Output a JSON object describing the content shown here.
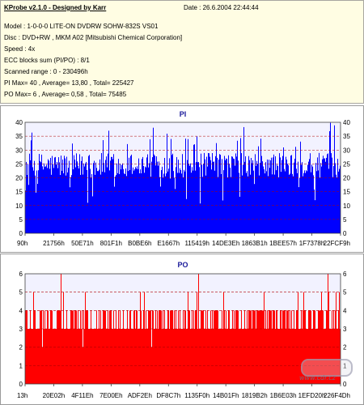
{
  "header": {
    "title": "KProbe v2.1.0 - Designed by Karr",
    "date": "Date : 26.6.2004 22:44:44",
    "lines": [
      "Model : 1-0-0-0 LITE-ON DVDRW SOHW-832S  VS01",
      "Disc : DVD+RW , MKM A02 [Mitsubishi Chemical Corporation]",
      "Speed : 4x",
      "ECC blocks sum (PI/PO) : 8/1",
      "Scanned range : 0 - 230496h",
      "PI Max= 40 , Average= 13,80 , Total= 225427",
      "PO Max= 6 , Average= 0,58 , Total= 75485"
    ]
  },
  "watermark": "www.cdr.cz",
  "chart_data": [
    {
      "type": "bar",
      "title": "PI",
      "color": "#0000ff",
      "ylim": [
        0,
        40
      ],
      "yticks": [
        0,
        5,
        10,
        15,
        20,
        25,
        30,
        35,
        40
      ],
      "x_tick_labels": [
        "90h",
        "21756h",
        "50E71h",
        "801F1h",
        "B0BE6h",
        "E1667h",
        "115419h",
        "14DE3Eh",
        "1863B1h",
        "1BEE57h",
        "1F7378h",
        "22FCF9h"
      ],
      "grid": true,
      "max": 40,
      "average": 13.8,
      "typical_range": [
        20,
        29
      ]
    },
    {
      "type": "bar",
      "title": "PO",
      "color": "#ff0000",
      "ylim": [
        0,
        6
      ],
      "yticks": [
        0,
        1,
        2,
        3,
        4,
        5,
        6
      ],
      "x_tick_labels": [
        "13h",
        "20E02h",
        "4F11Eh",
        "7E00Eh",
        "ADF2Eh",
        "DF8C7h",
        "1135F0h",
        "14B01Fh",
        "1819B2h",
        "1B6E03h",
        "1EFD20h",
        "226F4Dh"
      ],
      "grid": true,
      "max": 6,
      "average": 0.58,
      "typical_range": [
        3,
        4
      ]
    }
  ]
}
